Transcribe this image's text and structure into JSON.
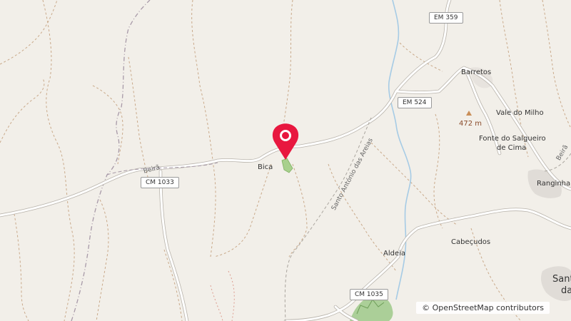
{
  "map": {
    "places": {
      "bica": "Bica",
      "barretos": "Barretos",
      "vale_do_milho": "Vale do Milho",
      "fonte_line1": "Fonte do Salgueiro",
      "fonte_line2": "de Cima",
      "ranginha": "Ranginha",
      "aldeia": "Aldeia",
      "cabecudos": "Cabeçudos",
      "sant_partial_1": "Sant",
      "sant_partial_2": "da"
    },
    "roads": {
      "em359": "EM 359",
      "em524": "EM 524",
      "cm1033": "CM 1033",
      "cm1035": "CM 1035",
      "beira_left": "Beirã",
      "beira_right": "Beirã",
      "santo_antonio": "Santo António das Areias"
    },
    "peak": {
      "elevation": "472 m"
    },
    "attribution": "© OpenStreetMap contributors",
    "colors": {
      "background": "#f2efe9",
      "road": "#ffffff",
      "road_casing": "#b9b4ac",
      "track": "#c9a98a",
      "river": "#a6cbe5",
      "marker": "#e8173f",
      "forest": "#a8d08d"
    },
    "marker_icon": "map-pin-icon"
  }
}
